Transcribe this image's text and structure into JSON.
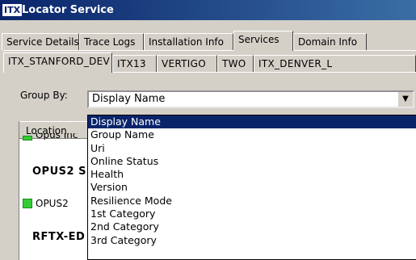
{
  "window": {
    "icon_text": "ITX",
    "title": "Locator Service"
  },
  "tabs_top": [
    "Service Details",
    "Trace Logs",
    "Installation Info",
    "Services",
    "Domain Info"
  ],
  "tabs_top_selected": "Services",
  "tabs_env": [
    "ITX_STANFORD_DEV",
    "ITX13",
    "VERTIGO",
    "TWO",
    "ITX_DENVER_L"
  ],
  "tabs_env_selected": "ITX_STANFORD_DEV",
  "group_by": {
    "label": "Group By:",
    "selected": "Display Name",
    "options": [
      "Display Name",
      "Group Name",
      "Uri",
      "Online Status",
      "Health",
      "Version",
      "Resilience Mode",
      "1st Category",
      "2nd Category",
      "3rd Category"
    ]
  },
  "grid": {
    "column_header": "Location",
    "partial_row_text": "Opus Inc",
    "rows": [
      {
        "kind": "group",
        "text": "OPUS2 S"
      },
      {
        "kind": "item",
        "text": "OPUS2",
        "status_color": "#33cc33"
      },
      {
        "kind": "group",
        "text": "RFTX-ED"
      }
    ]
  }
}
